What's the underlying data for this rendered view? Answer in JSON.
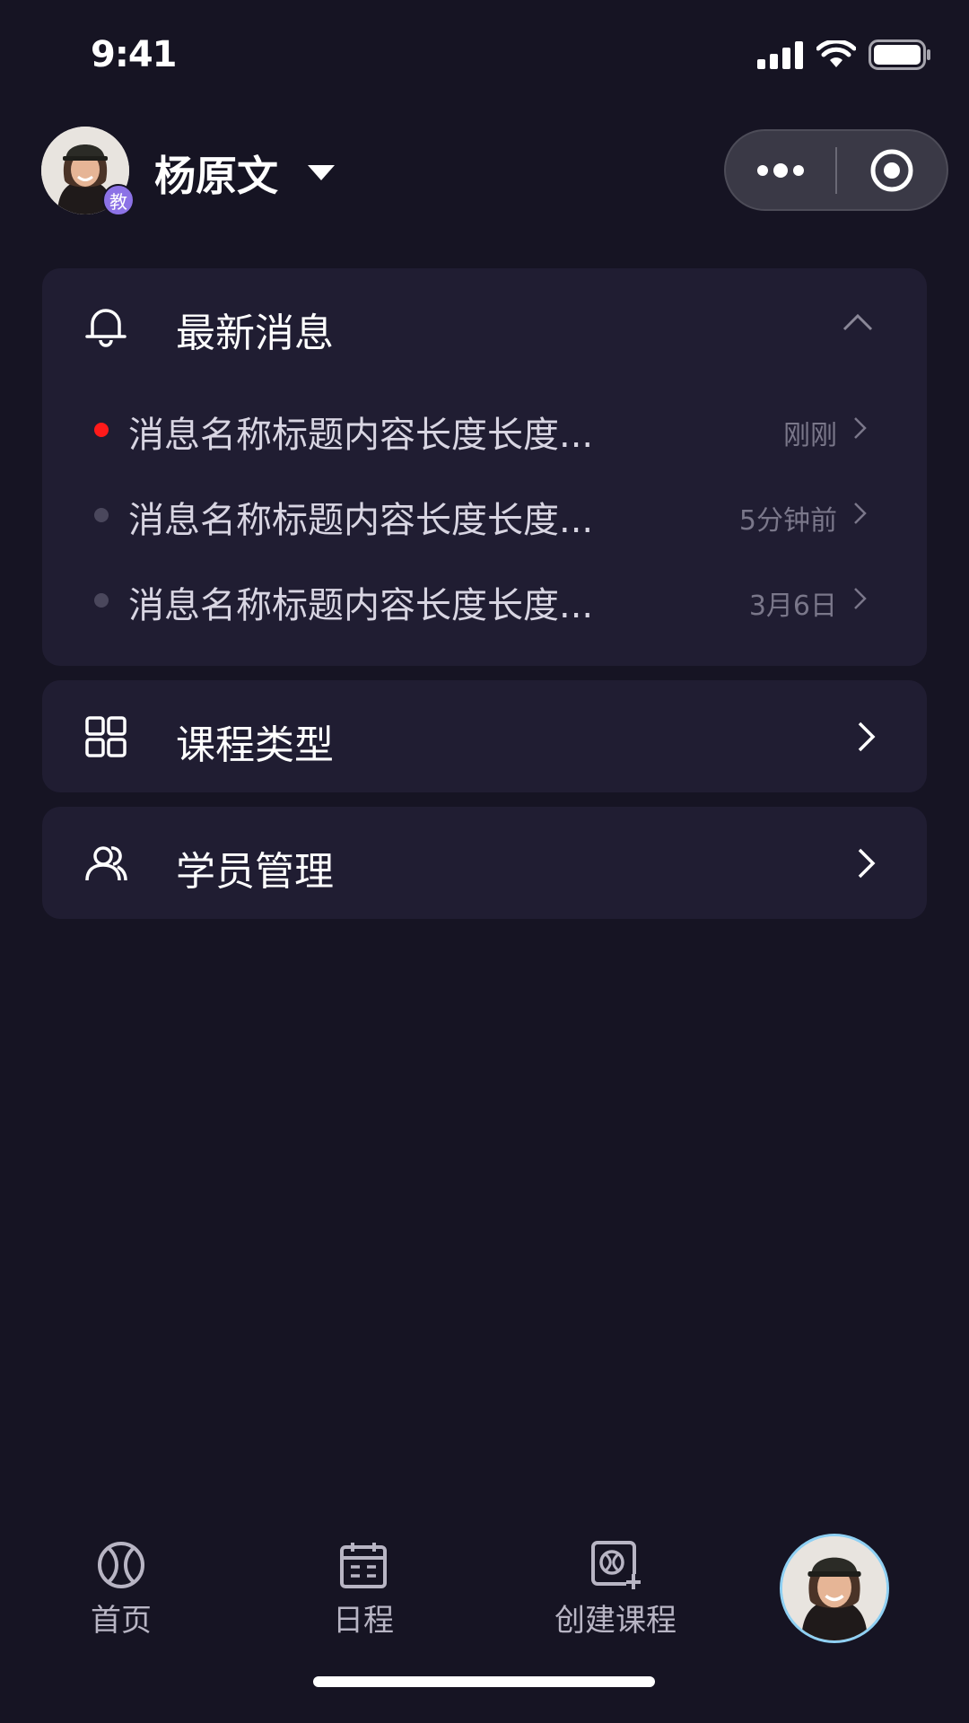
{
  "status_bar": {
    "time": "9:41"
  },
  "header": {
    "user_name": "杨原文",
    "role_badge": "教"
  },
  "messages_card": {
    "title": "最新消息",
    "items": [
      {
        "text": "消息名称标题内容长度长度...",
        "time": "刚刚",
        "unread": true
      },
      {
        "text": "消息名称标题内容长度长度...",
        "time": "5分钟前",
        "unread": false
      },
      {
        "text": "消息名称标题内容长度长度...",
        "time": "3月6日",
        "unread": false
      }
    ]
  },
  "course_card": {
    "title": "课程类型"
  },
  "student_card": {
    "title": "学员管理"
  },
  "tabbar": {
    "tabs": [
      {
        "label": "首页",
        "icon": "tennis-ball-icon"
      },
      {
        "label": "日程",
        "icon": "calendar-icon"
      },
      {
        "label": "创建课程",
        "icon": "create-course-icon"
      }
    ]
  },
  "colors": {
    "background": "#161423",
    "card": "#201d32",
    "unread_dot": "#ff1a1a",
    "read_dot": "#4a475c",
    "badge": "#8c72e6"
  }
}
